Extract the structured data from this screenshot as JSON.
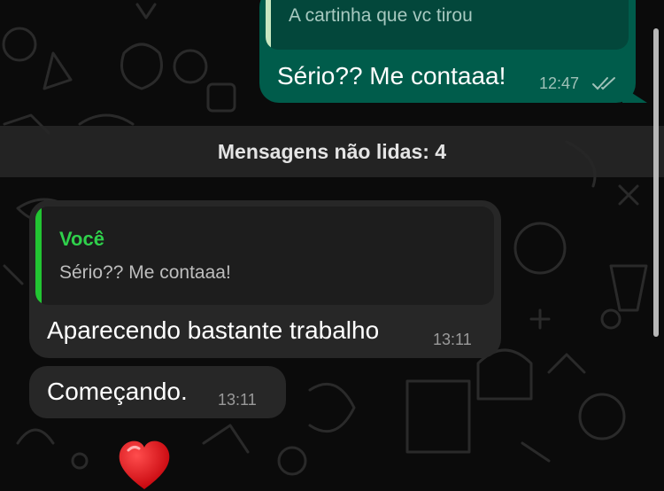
{
  "chat": {
    "outgoing": {
      "quote_text": "A cartinha que vc tirou",
      "text": "Sério?? Me contaaa!",
      "time": "12:47",
      "status_icon": "double-check-icon"
    },
    "unread_divider": "Mensagens não lidas: 4",
    "incoming": [
      {
        "quote_author": "Você",
        "quote_text": "Sério?? Me contaaa!",
        "text": "Aparecendo bastante trabalho",
        "time": "13:11"
      },
      {
        "text": "Começando.",
        "time": "13:11"
      }
    ],
    "reaction_icon": "red-heart-icon"
  },
  "colors": {
    "background": "#0b0b0b",
    "outgoing_bubble": "#005c4b",
    "incoming_bubble": "#272727",
    "quote_author": "#2fd04b",
    "heart": "#e8151c"
  }
}
